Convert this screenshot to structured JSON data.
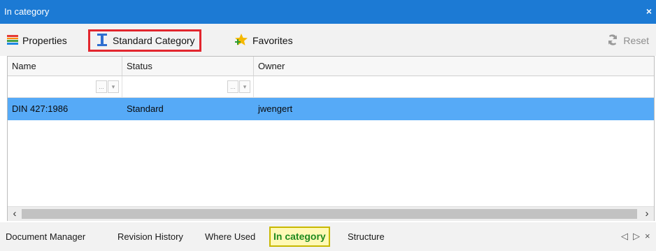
{
  "window": {
    "title": "In category",
    "close_glyph": "×"
  },
  "toolbar": {
    "items": [
      {
        "label": "Properties",
        "icon": "properties-icon"
      },
      {
        "label": "Standard Category",
        "icon": "standard-category-icon"
      },
      {
        "label": "Favorites",
        "icon": "favorites-star-icon"
      }
    ],
    "reset_label": "Reset"
  },
  "grid": {
    "columns": [
      "Name",
      "Status",
      "Owner"
    ],
    "rows": [
      {
        "name": "DIN 427:1986",
        "status": "Standard",
        "owner": "jwengert",
        "selected": true
      }
    ],
    "filter_button_glyphs": [
      "...",
      "▾"
    ]
  },
  "scrollbar": {
    "left_glyph": "‹",
    "right_glyph": "›"
  },
  "tabs": {
    "items": [
      "Document Manager",
      "Revision History",
      "Where Used",
      "In category",
      "Structure"
    ],
    "active": "In category",
    "nav_glyphs": [
      "◁",
      "▷",
      "×"
    ]
  },
  "colors": {
    "titlebar": "#1c7ad4",
    "selected_row": "#56aaf7",
    "highlight_box": "#e2262e",
    "active_tab_bg": "#fff9b5",
    "active_tab_text": "#1e8a1e"
  }
}
